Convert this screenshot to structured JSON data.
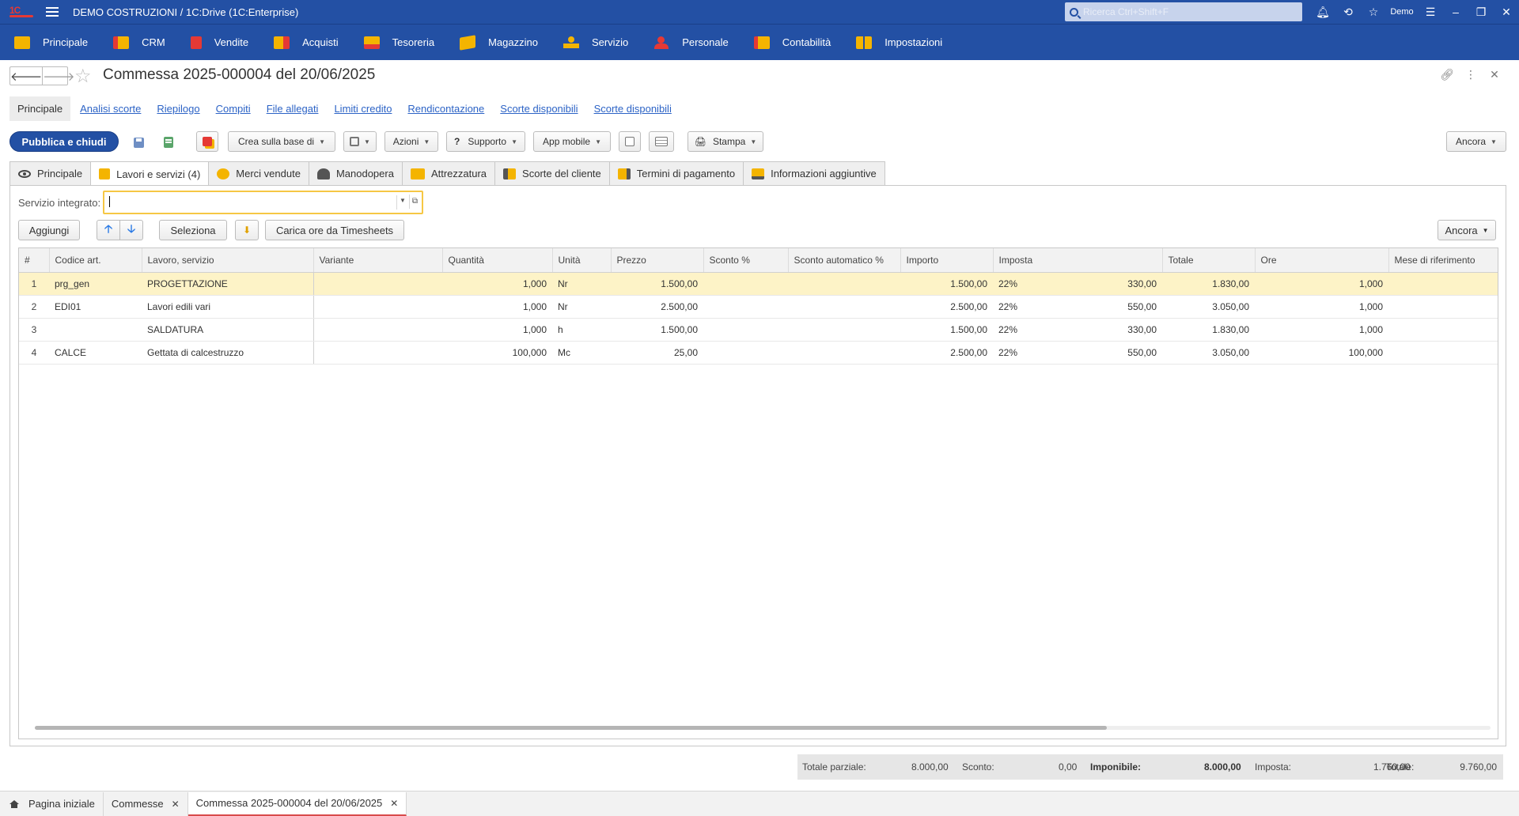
{
  "titlebar": {
    "logo_text": "1C",
    "title": "DEMO COSTRUZIONI / 1C:Drive  (1C:Enterprise)",
    "search_placeholder": "Ricerca Ctrl+Shift+F",
    "user": "Demo"
  },
  "sections": [
    {
      "label": "Principale",
      "icon": "home-section-icon"
    },
    {
      "label": "CRM",
      "icon": "crm-icon"
    },
    {
      "label": "Vendite",
      "icon": "sales-icon"
    },
    {
      "label": "Acquisti",
      "icon": "truck-icon"
    },
    {
      "label": "Tesoreria",
      "icon": "treasury-icon"
    },
    {
      "label": "Magazzino",
      "icon": "warehouse-box-icon"
    },
    {
      "label": "Servizio",
      "icon": "service-icon"
    },
    {
      "label": "Personale",
      "icon": "staff-icon"
    },
    {
      "label": "Contabilità",
      "icon": "accounting-icon"
    },
    {
      "label": "Impostazioni",
      "icon": "settings-icon"
    }
  ],
  "form": {
    "title": "Commessa 2025-000004 del 20/06/2025"
  },
  "links": [
    {
      "label": "Principale",
      "active": true
    },
    {
      "label": "Analisi scorte"
    },
    {
      "label": "Riepilogo"
    },
    {
      "label": "Compiti"
    },
    {
      "label": "File allegati"
    },
    {
      "label": "Limiti credito"
    },
    {
      "label": "Rendicontazione"
    },
    {
      "label": "Scorte disponibili"
    },
    {
      "label": "Scorte disponibili"
    }
  ],
  "toolbar": {
    "publish_close": "Pubblica e chiudi",
    "create_based": "Crea sulla base di",
    "actions": "Azioni",
    "support": "Supporto",
    "support_glyph": "?",
    "app_mobile": "App mobile",
    "print": "Stampa",
    "more": "Ancora"
  },
  "tabs": [
    {
      "label": "Principale"
    },
    {
      "label": "Lavori e servizi (4)",
      "active": true
    },
    {
      "label": "Merci vendute"
    },
    {
      "label": "Manodopera"
    },
    {
      "label": "Attrezzatura"
    },
    {
      "label": "Scorte del cliente"
    },
    {
      "label": "Termini di pagamento"
    },
    {
      "label": "Informazioni aggiuntive"
    }
  ],
  "panel": {
    "integrated_service_label": "Servizio integrato:",
    "integrated_service_value": "",
    "add": "Aggiungi",
    "select": "Seleziona",
    "load_hours": "Carica ore da Timesheets",
    "more": "Ancora"
  },
  "grid": {
    "columns": [
      "#",
      "Codice art.",
      "Lavoro, servizio",
      "Variante",
      "Quantità",
      "Unità",
      "Prezzo",
      "Sconto %",
      "Sconto automatico %",
      "Importo",
      "Imposta",
      "",
      "Totale",
      "Ore",
      "Mese di riferimento"
    ],
    "rows": [
      [
        "1",
        "prg_gen",
        "PROGETTAZIONE",
        "",
        "1,000",
        "Nr",
        "1.500,00",
        "",
        "",
        "1.500,00",
        "22%",
        "330,00",
        "1.830,00",
        "1,000",
        ""
      ],
      [
        "2",
        "EDI01",
        "Lavori edili vari",
        "",
        "1,000",
        "Nr",
        "2.500,00",
        "",
        "",
        "2.500,00",
        "22%",
        "550,00",
        "3.050,00",
        "1,000",
        ""
      ],
      [
        "3",
        "",
        "SALDATURA",
        "",
        "1,000",
        "h",
        "1.500,00",
        "",
        "",
        "1.500,00",
        "22%",
        "330,00",
        "1.830,00",
        "1,000",
        ""
      ],
      [
        "4",
        "CALCE",
        "Gettata di calcestruzzo",
        "",
        "100,000",
        "Mc",
        "25,00",
        "",
        "",
        "2.500,00",
        "22%",
        "550,00",
        "3.050,00",
        "100,000",
        ""
      ]
    ]
  },
  "totals": {
    "subtotal_label": "Totale parziale:",
    "subtotal": "8.000,00",
    "discount_label": "Sconto:",
    "discount": "0,00",
    "taxable_label": "Imponibile:",
    "taxable": "8.000,00",
    "tax_label": "Imposta:",
    "tax": "1.760,00",
    "total_label": "Totale:",
    "total": "9.760,00"
  },
  "bottom_tabs": [
    {
      "label": "Pagina iniziale"
    },
    {
      "label": "Commesse"
    },
    {
      "label": "Commessa 2025-000004 del 20/06/2025",
      "active": true
    }
  ],
  "colors": {
    "brand_blue": "#2350a4",
    "selection": "#fdf3c7",
    "focus": "#f6c744"
  }
}
